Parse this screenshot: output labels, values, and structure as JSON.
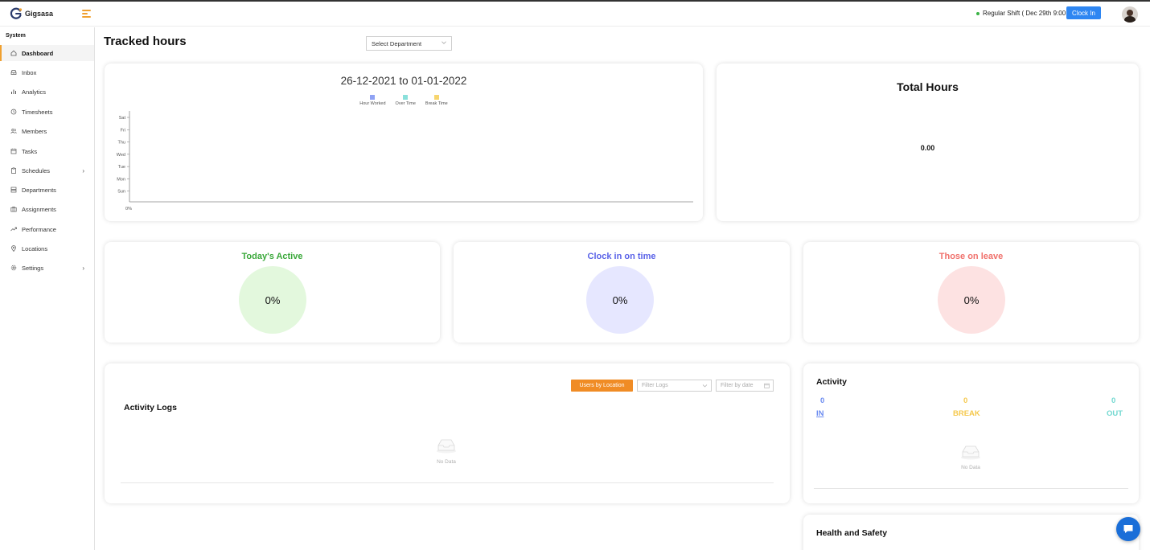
{
  "app": {
    "name": "Gigsasa"
  },
  "header": {
    "shift_text": "Regular Shift ( Dec 29th 9:00 )",
    "clock_in_label": "Clock In",
    "status_color": "#3bb346",
    "accent_color": "#2e86f2"
  },
  "sidebar": {
    "section_title": "System",
    "items": [
      {
        "label": "Dashboard",
        "icon": "home-icon",
        "active": true
      },
      {
        "label": "Inbox",
        "icon": "inbox-icon"
      },
      {
        "label": "Analytics",
        "icon": "bar-chart-icon"
      },
      {
        "label": "Timesheets",
        "icon": "clock-icon"
      },
      {
        "label": "Members",
        "icon": "users-icon"
      },
      {
        "label": "Tasks",
        "icon": "calendar-icon"
      },
      {
        "label": "Schedules",
        "icon": "clipboard-icon",
        "has_submenu": true
      },
      {
        "label": "Departments",
        "icon": "database-icon"
      },
      {
        "label": "Assignments",
        "icon": "briefcase-icon"
      },
      {
        "label": "Performance",
        "icon": "trend-up-icon"
      },
      {
        "label": "Locations",
        "icon": "map-pin-icon"
      },
      {
        "label": "Settings",
        "icon": "gear-icon",
        "has_submenu": true
      }
    ]
  },
  "main": {
    "title": "Tracked hours",
    "department_select": "Select Department"
  },
  "chart_data": {
    "type": "bar",
    "orientation": "horizontal",
    "title": "26-12-2021 to 01-01-2022",
    "categories": [
      "Sat",
      "Fri",
      "Thu",
      "Wed",
      "Tue",
      "Mon",
      "Sun"
    ],
    "series": [
      {
        "name": "Hour Worked",
        "color": "#8fa2f4",
        "values": [
          0,
          0,
          0,
          0,
          0,
          0,
          0
        ]
      },
      {
        "name": "Over Time",
        "color": "#8ae0db",
        "values": [
          0,
          0,
          0,
          0,
          0,
          0,
          0
        ]
      },
      {
        "name": "Break Time",
        "color": "#f7d56e",
        "values": [
          0,
          0,
          0,
          0,
          0,
          0,
          0
        ]
      }
    ],
    "x_tick_labels": [
      "0%"
    ],
    "xlim": [
      0,
      0
    ],
    "grid": false,
    "legend": "top"
  },
  "total_hours": {
    "title": "Total Hours",
    "value": "0.00"
  },
  "stats": [
    {
      "title": "Today's Active",
      "value": "0%",
      "title_color": "#3aa83a",
      "circle_color": "#e3f8dd"
    },
    {
      "title": "Clock in on time",
      "value": "0%",
      "title_color": "#5a63e8",
      "circle_color": "#e6e7ff"
    },
    {
      "title": "Those on leave",
      "value": "0%",
      "title_color": "#f0716c",
      "circle_color": "#fde2e2"
    }
  ],
  "activity_logs": {
    "title": "Activity Logs",
    "users_by_location_label": "Users by Location",
    "filter_logs_placeholder": "Filter Logs",
    "filter_date_placeholder": "Filter by date",
    "empty_text": "No Data",
    "button_color": "#f08c25"
  },
  "activity": {
    "title": "Activity",
    "in": {
      "value": "0",
      "label": "IN",
      "color": "#6b8bf0"
    },
    "break": {
      "value": "0",
      "label": "BREAK",
      "color": "#f5c84c"
    },
    "out": {
      "value": "0",
      "label": "OUT",
      "color": "#72d8d0"
    },
    "empty_text": "No Data"
  },
  "health_safety": {
    "title": "Health and Safety"
  }
}
